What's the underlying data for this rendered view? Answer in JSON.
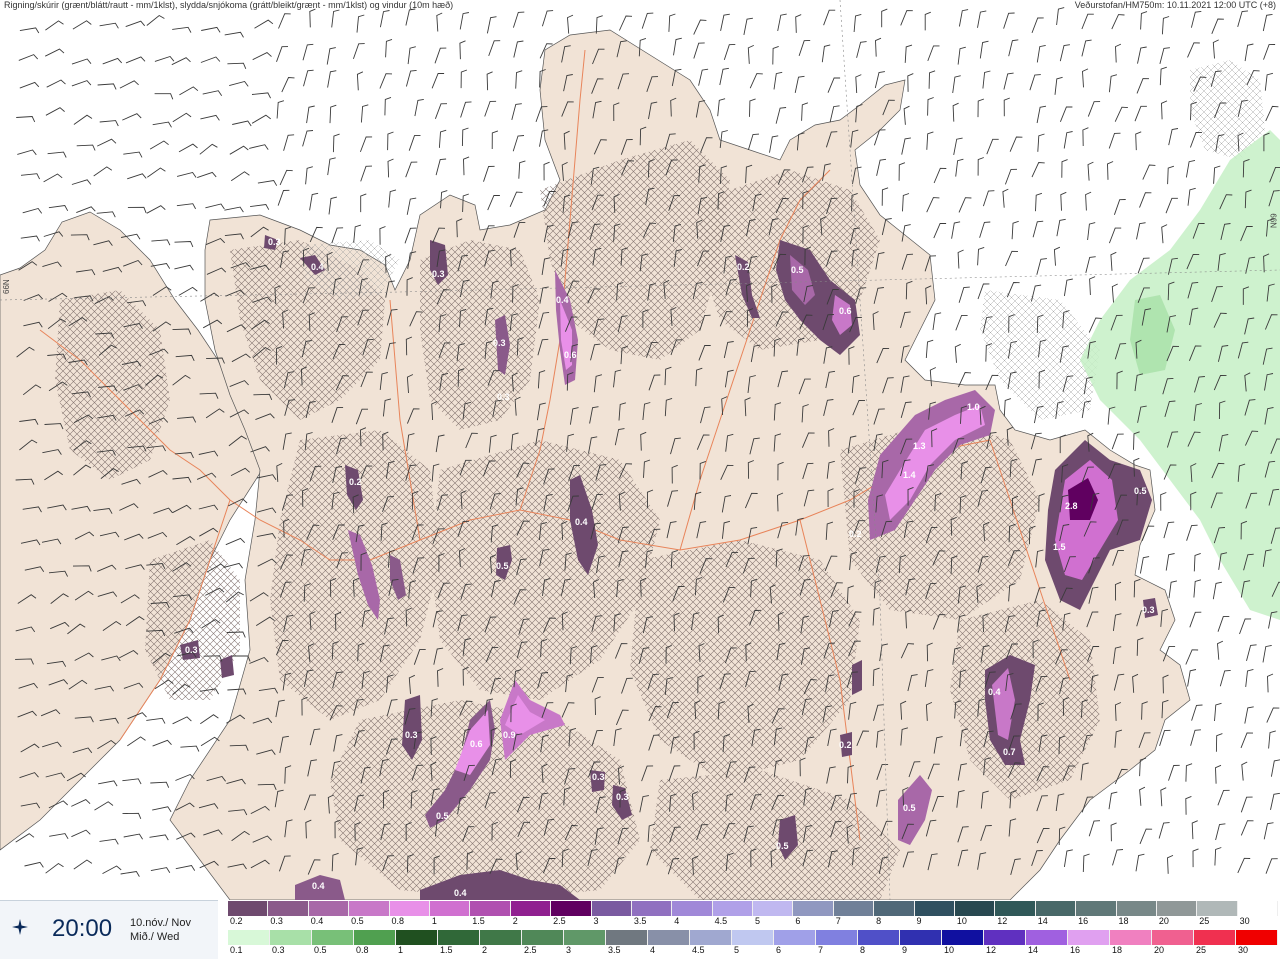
{
  "header": {
    "left": "Rigning/skúrir (grænt/blátt/rautt - mm/1klst), slydda/snjókoma (grátt/bleikt/grænt - mm/1klst) og vindur (10m hæð)",
    "right": "Veðurstofan/HM750m: 10.11.2021 12:00 UTC (+8)"
  },
  "latitude_label": "66N",
  "time_panel": {
    "time": "20:00",
    "date_line1": "10.nóv./ Nov",
    "date_line2": "Mið./ Wed",
    "icon": "compass-star-icon"
  },
  "map_values": [
    {
      "text": "0.3"
    },
    {
      "text": "0.4"
    },
    {
      "text": "0.3"
    },
    {
      "text": "0.4"
    },
    {
      "text": "0.6"
    },
    {
      "text": "0.3"
    },
    {
      "text": "0.3"
    },
    {
      "text": "0.5"
    },
    {
      "text": "0.6"
    },
    {
      "text": "0.2"
    },
    {
      "text": "1.0"
    },
    {
      "text": "1.3"
    },
    {
      "text": "1.4"
    },
    {
      "text": "0.2"
    },
    {
      "text": "2.8"
    },
    {
      "text": "0.5"
    },
    {
      "text": "1.5"
    },
    {
      "text": "0.3"
    },
    {
      "text": "0.4"
    },
    {
      "text": "0.5"
    },
    {
      "text": "0.4"
    },
    {
      "text": "0.6"
    },
    {
      "text": "0.9"
    },
    {
      "text": "0.3"
    },
    {
      "text": "0.5"
    },
    {
      "text": "0.3"
    },
    {
      "text": "0.3"
    },
    {
      "text": "0.5"
    },
    {
      "text": "0.2"
    },
    {
      "text": "0.5"
    },
    {
      "text": "0.7"
    },
    {
      "text": "0.4"
    },
    {
      "text": "0.4"
    },
    {
      "text": "0.3"
    },
    {
      "text": "0.2"
    }
  ],
  "legend": {
    "row1": {
      "labels": [
        "0.2",
        "0.3",
        "0.4",
        "0.5",
        "0.8",
        "1",
        "1.5",
        "2",
        "2.5",
        "3",
        "3.5",
        "4",
        "4.5",
        "5",
        "6",
        "7",
        "8",
        "9",
        "10",
        "12",
        "14",
        "16",
        "18",
        "20",
        "25",
        "30"
      ],
      "colors": [
        "#6e4a6e",
        "#8a5a8a",
        "#a868a8",
        "#c878c8",
        "#e890e8",
        "#d070d0",
        "#b050b0",
        "#902090",
        "#600060",
        "#7a5aa0",
        "#9070c0",
        "#a088d8",
        "#b0a0e8",
        "#c0b8f0",
        "#9098c0",
        "#708098",
        "#506878",
        "#305060",
        "#284850",
        "#305858",
        "#486868",
        "#607878",
        "#788888",
        "#909898",
        "#b0b8b8",
        "#ffffff"
      ]
    },
    "row2": {
      "labels": [
        "0.1",
        "0.3",
        "0.5",
        "0.8",
        "1",
        "1.5",
        "2",
        "2.5",
        "3",
        "3.5",
        "4",
        "4.5",
        "5",
        "6",
        "7",
        "8",
        "9",
        "10",
        "12",
        "14",
        "16",
        "18",
        "20",
        "25",
        "30"
      ],
      "colors": [
        "#d8f8d8",
        "#a8e0a8",
        "#78c078",
        "#50a050",
        "#205020",
        "#306838",
        "#407848",
        "#508858",
        "#609868",
        "#707880",
        "#8890a8",
        "#a0a8d0",
        "#c0c8f0",
        "#a0a0e8",
        "#8080e0",
        "#5050c8",
        "#3030b0",
        "#1010a0",
        "#6030c0",
        "#a060e0",
        "#e0a0f0",
        "#f080c0",
        "#f06090",
        "#f03050",
        "#f00000"
      ]
    }
  }
}
